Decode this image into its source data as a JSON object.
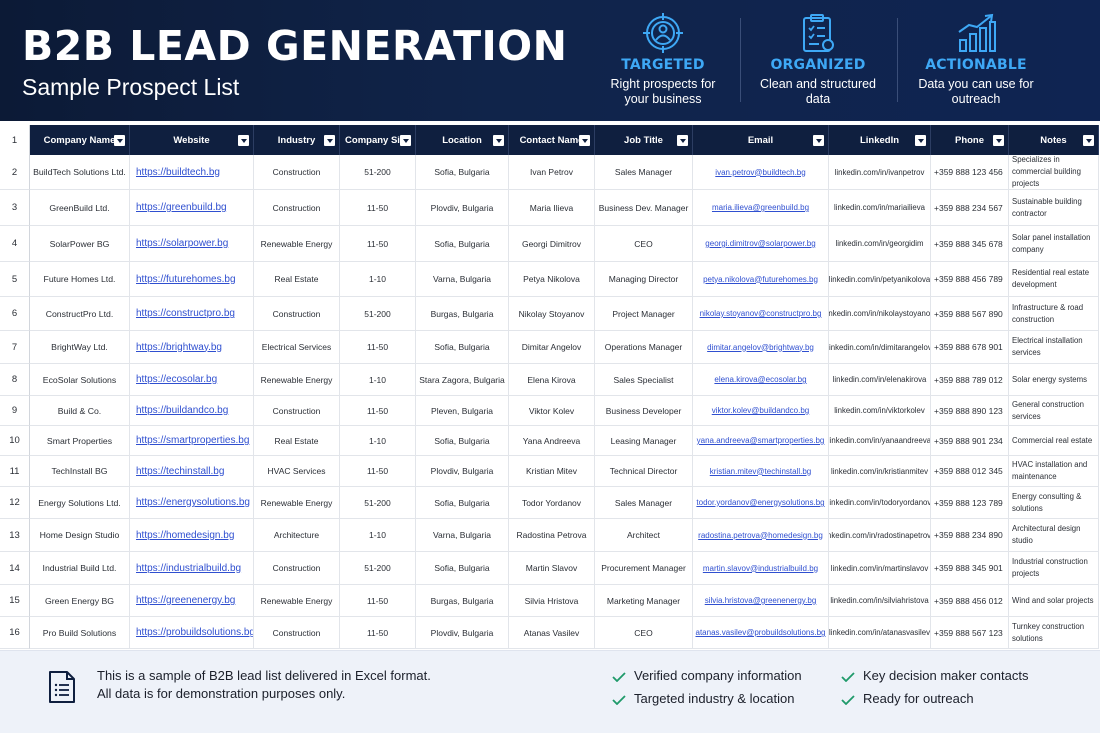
{
  "header": {
    "title": "B2B LEAD GENERATION",
    "subtitle": "Sample Prospect List",
    "features": [
      {
        "icon": "target-person-icon",
        "title": "TARGETED",
        "line1": "Right prospects for",
        "line2": "your business"
      },
      {
        "icon": "clipboard-icon",
        "title": "ORGANIZED",
        "line1": "Clean and structured",
        "line2": "data"
      },
      {
        "icon": "growth-chart-icon",
        "title": "ACTIONABLE",
        "line1": "Data you can use for",
        "line2": "outreach"
      }
    ]
  },
  "table": {
    "header_row_number": "1",
    "columns": [
      "Company Name",
      "Website",
      "Industry",
      "Company Size",
      "Location",
      "Contact Name",
      "Job Title",
      "Email",
      "LinkedIn",
      "Phone",
      "Notes"
    ],
    "rows": [
      {
        "n": "2",
        "company": "BuildTech Solutions Ltd.",
        "website": "https://buildtech.bg",
        "industry": "Construction",
        "size": "51-200",
        "location": "Sofia, Bulgaria",
        "contact": "Ivan Petrov",
        "job": "Sales Manager",
        "email": "ivan.petrov@buildtech.bg",
        "linkedin": "linkedin.com/in/ivanpetrov",
        "phone": "+359 888 123 456",
        "notes": "Specializes in commercial building projects"
      },
      {
        "n": "3",
        "company": "GreenBuild Ltd.",
        "website": "https://greenbuild.bg",
        "industry": "Construction",
        "size": "11-50",
        "location": "Plovdiv, Bulgaria",
        "contact": "Maria Ilieva",
        "job": "Business Dev. Manager",
        "email": "maria.ilieva@greenbuild.bg",
        "linkedin": "linkedin.com/in/mariailieva",
        "phone": "+359 888 234 567",
        "notes": "Sustainable building contractor"
      },
      {
        "n": "4",
        "company": "SolarPower BG",
        "website": "https://solarpower.bg",
        "industry": "Renewable Energy",
        "size": "11-50",
        "location": "Sofia, Bulgaria",
        "contact": "Georgi Dimitrov",
        "job": "CEO",
        "email": "georgi.dimitrov@solarpower.bg",
        "linkedin": "linkedin.com/in/georgidim",
        "phone": "+359 888 345 678",
        "notes": "Solar panel installation company"
      },
      {
        "n": "5",
        "company": "Future Homes Ltd.",
        "website": "https://futurehomes.bg",
        "industry": "Real Estate",
        "size": "1-10",
        "location": "Varna, Bulgaria",
        "contact": "Petya Nikolova",
        "job": "Managing Director",
        "email": "petya.nikolova@futurehomes.bg",
        "linkedin": "linkedin.com/in/petyanikolova",
        "phone": "+359 888 456 789",
        "notes": "Residential real estate development"
      },
      {
        "n": "6",
        "company": "ConstructPro Ltd.",
        "website": "https://constructpro.bg",
        "industry": "Construction",
        "size": "51-200",
        "location": "Burgas, Bulgaria",
        "contact": "Nikolay Stoyanov",
        "job": "Project Manager",
        "email": "nikolay.stoyanov@constructpro.bg",
        "linkedin": "linkedin.com/in/nikolaystoyanov",
        "phone": "+359 888 567 890",
        "notes": "Infrastructure & road construction"
      },
      {
        "n": "7",
        "company": "BrightWay Ltd.",
        "website": "https://brightway.bg",
        "industry": "Electrical Services",
        "size": "11-50",
        "location": "Sofia, Bulgaria",
        "contact": "Dimitar Angelov",
        "job": "Operations Manager",
        "email": "dimitar.angelov@brightway.bg",
        "linkedin": "linkedin.com/in/dimitarangelov",
        "phone": "+359 888 678 901",
        "notes": "Electrical installation services"
      },
      {
        "n": "8",
        "company": "EcoSolar Solutions",
        "website": "https://ecosolar.bg",
        "industry": "Renewable Energy",
        "size": "1-10",
        "location": "Stara Zagora, Bulgaria",
        "contact": "Elena Kirova",
        "job": "Sales Specialist",
        "email": "elena.kirova@ecosolar.bg",
        "linkedin": "linkedin.com/in/elenakirova",
        "phone": "+359 888 789 012",
        "notes": "Solar energy systems"
      },
      {
        "n": "9",
        "company": "Build & Co.",
        "website": "https://buildandco.bg",
        "industry": "Construction",
        "size": "11-50",
        "location": "Pleven, Bulgaria",
        "contact": "Viktor Kolev",
        "job": "Business Developer",
        "email": "viktor.kolev@buildandco.bg",
        "linkedin": "linkedin.com/in/viktorkolev",
        "phone": "+359 888 890 123",
        "notes": "General construction services"
      },
      {
        "n": "10",
        "company": "Smart Properties",
        "website": "https://smartproperties.bg",
        "industry": "Real Estate",
        "size": "1-10",
        "location": "Sofia, Bulgaria",
        "contact": "Yana Andreeva",
        "job": "Leasing Manager",
        "email": "yana.andreeva@smartproperties.bg",
        "linkedin": "linkedin.com/in/yanaandreeva",
        "phone": "+359 888 901 234",
        "notes": "Commercial real estate"
      },
      {
        "n": "11",
        "company": "TechInstall BG",
        "website": "https://techinstall.bg",
        "industry": "HVAC Services",
        "size": "11-50",
        "location": "Plovdiv, Bulgaria",
        "contact": "Kristian Mitev",
        "job": "Technical Director",
        "email": "kristian.mitev@techinstall.bg",
        "linkedin": "linkedin.com/in/kristianmitev",
        "phone": "+359 888 012 345",
        "notes": "HVAC installation and maintenance"
      },
      {
        "n": "12",
        "company": "Energy Solutions Ltd.",
        "website": "https://energysolutions.bg",
        "industry": "Renewable Energy",
        "size": "51-200",
        "location": "Sofia, Bulgaria",
        "contact": "Todor Yordanov",
        "job": "Sales Manager",
        "email": "todor.yordanov@energysolutions.bg",
        "linkedin": "linkedin.com/in/todoryordanov",
        "phone": "+359 888 123 789",
        "notes": "Energy consulting & solutions"
      },
      {
        "n": "13",
        "company": "Home Design Studio",
        "website": "https://homedesign.bg",
        "industry": "Architecture",
        "size": "1-10",
        "location": "Varna, Bulgaria",
        "contact": "Radostina Petrova",
        "job": "Architect",
        "email": "radostina.petrova@homedesign.bg",
        "linkedin": "linkedin.com/in/radostinapetrova",
        "phone": "+359 888 234 890",
        "notes": "Architectural design studio"
      },
      {
        "n": "14",
        "company": "Industrial Build Ltd.",
        "website": "https://industrialbuild.bg",
        "industry": "Construction",
        "size": "51-200",
        "location": "Sofia, Bulgaria",
        "contact": "Martin Slavov",
        "job": "Procurement Manager",
        "email": "martin.slavov@industrialbuild.bg",
        "linkedin": "linkedin.com/in/martinslavov",
        "phone": "+359 888 345 901",
        "notes": "Industrial construction projects"
      },
      {
        "n": "15",
        "company": "Green Energy BG",
        "website": "https://greenenergy.bg",
        "industry": "Renewable Energy",
        "size": "11-50",
        "location": "Burgas, Bulgaria",
        "contact": "Silvia Hristova",
        "job": "Marketing Manager",
        "email": "silvia.hristova@greenenergy.bg",
        "linkedin": "linkedin.com/in/silviahristova",
        "phone": "+359 888 456 012",
        "notes": "Wind and solar projects"
      },
      {
        "n": "16",
        "company": "Pro Build Solutions",
        "website": "https://probuildsolutions.bg",
        "industry": "Construction",
        "size": "11-50",
        "location": "Plovdiv, Bulgaria",
        "contact": "Atanas Vasilev",
        "job": "CEO",
        "email": "atanas.vasilev@probuildsolutions.bg",
        "linkedin": "linkedin.com/in/atanasvasilev",
        "phone": "+359 888 567 123",
        "notes": "Turnkey construction solutions"
      }
    ]
  },
  "footer": {
    "note_prefix": "This is a sample of ",
    "note_bold1": "B2B lead list",
    "note_mid": " delivered in ",
    "note_bold2": "Excel",
    "note_suffix": " format.",
    "note_line2": "All data is for demonstration purposes only.",
    "checks": [
      "Verified company information",
      "Targeted industry & location",
      "Key decision maker contacts",
      "Ready for outreach"
    ]
  },
  "colors": {
    "banner": "#0f1f3f",
    "accent": "#3ea8f5",
    "header_cell": "#0f1f3f",
    "link": "#2f4fd0",
    "check": "#1f9a6a",
    "footer_bg": "#eef2f9"
  }
}
